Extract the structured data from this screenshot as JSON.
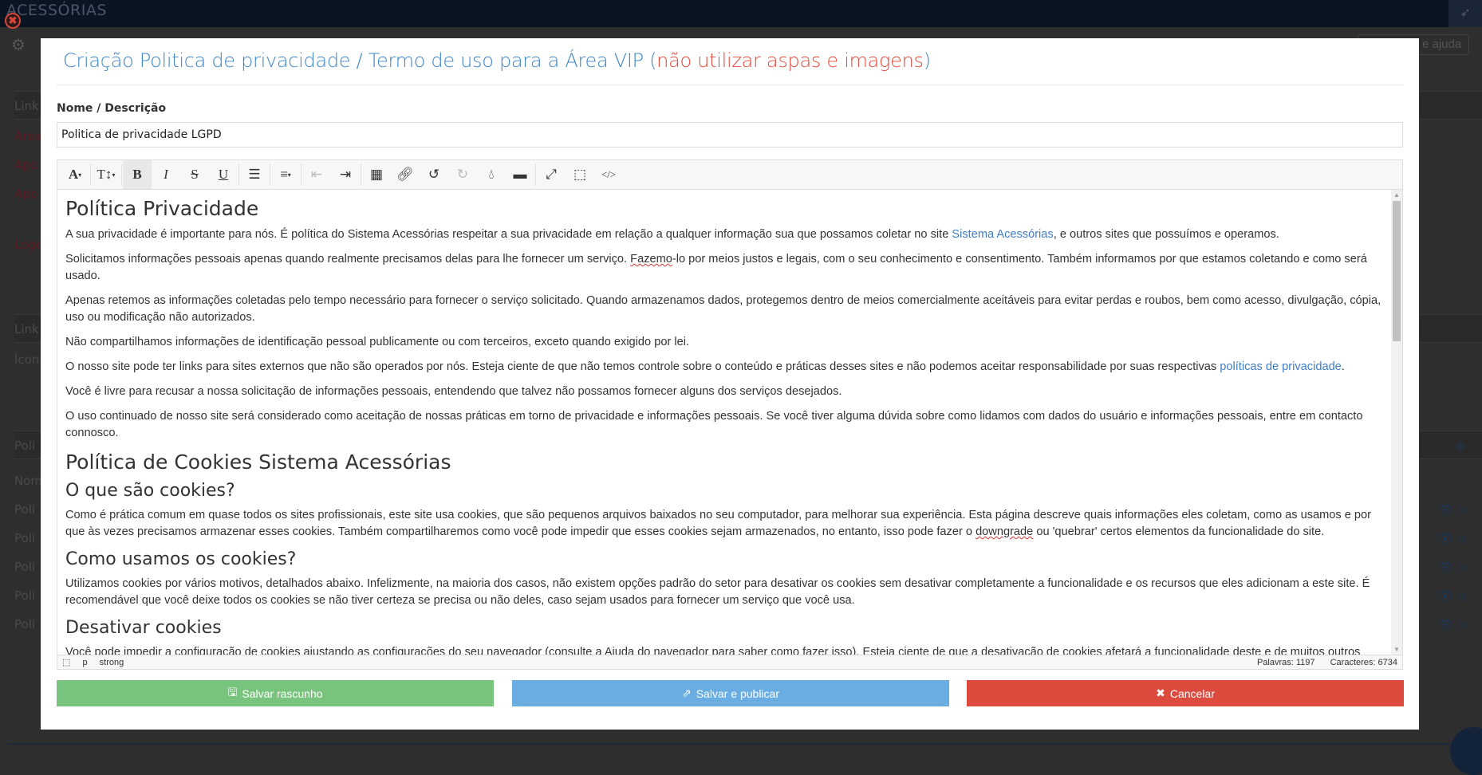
{
  "app": {
    "brand": "ACESSÓRIAS",
    "help_placeholder": "e ajuda"
  },
  "background": {
    "rows": [
      "Link",
      "Área",
      "App",
      "App",
      "Logo",
      "Link",
      "Ícon",
      "Poli",
      "Nom",
      "Poli",
      "Poli",
      "Poli",
      "Poli",
      "Poli"
    ]
  },
  "modal": {
    "title": "Criação Politica de privacidade / Termo de uso para a Área VIP (",
    "title_warning": "não utilizar aspas e imagens",
    "title_close": ")",
    "name_label": "Nome / Descrição",
    "name_value": "Politica de privacidade LGPD",
    "toolbar": [
      "font-icon",
      "text-size-icon",
      "bold-icon",
      "italic-icon",
      "strikethrough-icon",
      "underline-icon",
      "bullet-list-icon",
      "align-icon",
      "outdent-icon",
      "indent-icon",
      "table-icon",
      "link-icon",
      "undo-icon",
      "redo-icon",
      "color-drop-icon",
      "horizontal-rule-icon",
      "fullscreen-icon",
      "select-all-icon",
      "code-view-icon"
    ],
    "content": {
      "h1_privacy": "Política Privacidade",
      "p1_a": "A sua privacidade é importante para nós. É política do Sistema Acessórias respeitar a sua privacidade em relação a qualquer informação sua que possamos coletar no site ",
      "p1_link": "Sistema Acessórias",
      "p1_b": ", e outros sites que possuímos e operamos.",
      "p2_a": "Solicitamos informações pessoais apenas quando realmente precisamos delas para lhe fornecer um serviço. ",
      "p2_spell": "Fazemo",
      "p2_b": "-lo por meios justos e legais, com o seu conhecimento e consentimento. Também informamos por que estamos coletando e como será usado.",
      "p3": "Apenas retemos as informações coletadas pelo tempo necessário para fornecer o serviço solicitado. Quando armazenamos dados, protegemos dentro de meios comercialmente aceitáveis para evitar perdas e roubos, bem como acesso, divulgação, cópia, uso ou modificação não autorizados.",
      "p4": "Não compartilhamos informações de identificação pessoal publicamente ou com terceiros, exceto quando exigido por lei.",
      "p5_a": "O nosso site pode ter links para sites externos que não são operados por nós. Esteja ciente de que não temos controle sobre o conteúdo e práticas desses sites e não podemos aceitar responsabilidade por suas respectivas ",
      "p5_link": "políticas de privacidade",
      "p5_b": ".",
      "p6": "Você é livre para recusar a nossa solicitação de informações pessoais, entendendo que talvez não possamos fornecer alguns dos serviços desejados.",
      "p7": "O uso continuado de nosso site será considerado como aceitação de nossas práticas em torno de privacidade e informações pessoais. Se você tiver alguma dúvida sobre como lidamos com dados do usuário e informações pessoais, entre em contacto connosco.",
      "h1_cookies": "Política de Cookies Sistema Acessórias",
      "h2_what": "O que são cookies?",
      "p8_a": "Como é prática comum em quase todos os sites profissionais, este site usa cookies, que são pequenos arquivos baixados no seu computador, para melhorar sua experiência. Esta página descreve quais informações eles coletam, como as usamos e por que às vezes precisamos armazenar esses cookies. Também compartilharemos como você pode impedir que esses cookies sejam armazenados, no entanto, isso pode fazer o ",
      "p8_spell": "downgrade",
      "p8_b": " ou 'quebrar' certos elementos da funcionalidade do site.",
      "h2_how": "Como usamos os cookies?",
      "p9": "Utilizamos cookies por vários motivos, detalhados abaixo. Infelizmente, na maioria dos casos, não existem opções padrão do setor para desativar os cookies sem desativar completamente a funcionalidade e os recursos que eles adicionam a este site. É recomendável que você deixe todos os cookies se não tiver certeza se precisa ou não deles, caso sejam usados para fornecer um serviço que você usa.",
      "h2_disable": "Desativar cookies",
      "p10": "Você pode impedir a configuração de cookies ajustando as configurações do seu navegador (consulte a Ajuda do navegador para saber como fazer isso). Esteja ciente de que a desativação de cookies afetará a funcionalidade deste e de muitos outros sites que você visita. A desativação de cookies geralmente resultará na desativação de determinadas funcionalidades e recursos deste site. Portanto, é recomendável que você não desative os cookies."
    },
    "status": {
      "path": [
        "p",
        "strong"
      ],
      "words": "Palavras: 1197",
      "chars": "Caracteres: 6734"
    },
    "buttons": {
      "draft": "Salvar rascunho",
      "publish": "Salvar e publicar",
      "cancel": "Cancelar"
    }
  },
  "colors": {
    "title": "#3f86c8",
    "warning": "#e6493b",
    "green": "#78c47d",
    "blue": "#6aade3",
    "red": "#dd4b3f"
  }
}
